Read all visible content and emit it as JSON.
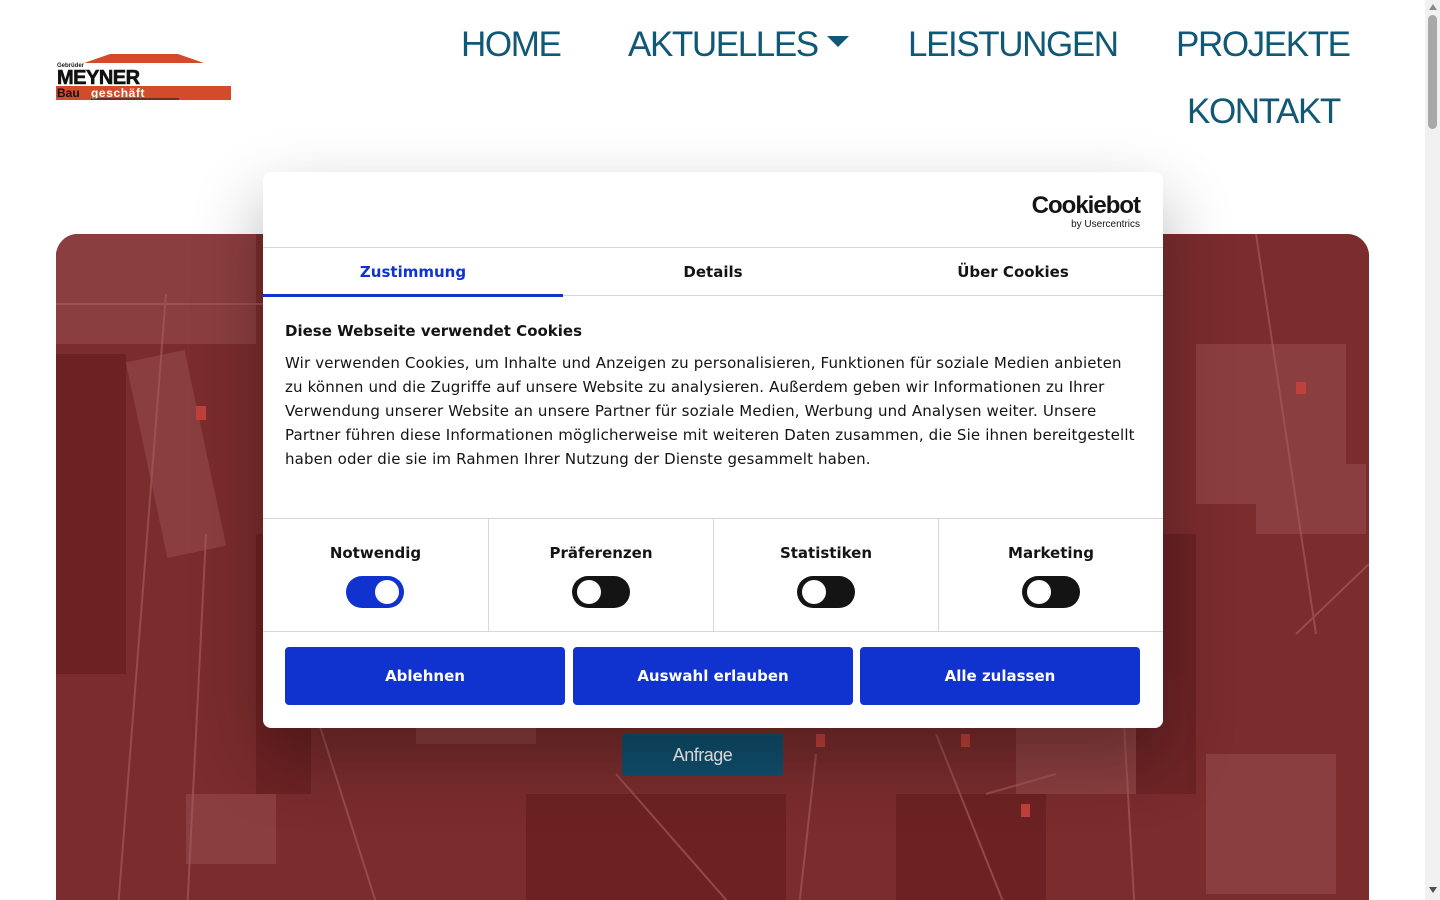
{
  "header": {
    "logo": {
      "top_line": "Gebrüder",
      "name": "MEYNER",
      "sub_left": "Bau",
      "sub_right": "geschäft"
    },
    "nav": {
      "home": "HOME",
      "aktuelles": "AKTUELLES",
      "leistungen": "LEISTUNGEN",
      "projekte": "PROJEKTE",
      "kontakt": "KONTAKT"
    }
  },
  "hero": {
    "cta_label": "Anfrage"
  },
  "cookie_dialog": {
    "brand": {
      "name": "Cookiebot",
      "byline": "by Usercentrics"
    },
    "tabs": {
      "consent": "Zustimmung",
      "details": "Details",
      "about": "Über Cookies",
      "active": "Zustimmung"
    },
    "title": "Diese Webseite verwendet Cookies",
    "body": "Wir verwenden Cookies, um Inhalte und Anzeigen zu personalisieren, Funktionen für soziale Medien anbieten zu können und die Zugriffe auf unsere Website zu analysieren. Außerdem geben wir Informationen zu Ihrer Verwendung unserer Website an unsere Partner für soziale Medien, Werbung und Analysen weiter. Unsere Partner führen diese Informationen möglicherweise mit weiteren Daten zusammen, die Sie ihnen bereitgestellt haben oder die sie im Rahmen Ihrer Nutzung der Dienste gesammelt haben.",
    "categories": {
      "necessary": {
        "label": "Notwendig",
        "enabled": true
      },
      "preferences": {
        "label": "Präferenzen",
        "enabled": false
      },
      "statistics": {
        "label": "Statistiken",
        "enabled": false
      },
      "marketing": {
        "label": "Marketing",
        "enabled": false
      }
    },
    "buttons": {
      "decline": "Ablehnen",
      "allow_selection": "Auswahl erlauben",
      "allow_all": "Alle zulassen"
    }
  },
  "colors": {
    "nav_text": "#105876",
    "brand_red": "#d24b2a",
    "hero_overlay": "#7a2b2c",
    "cta_background": "#10506f",
    "cookiebot_blue": "#1032cf",
    "toggle_off": "#141414"
  }
}
